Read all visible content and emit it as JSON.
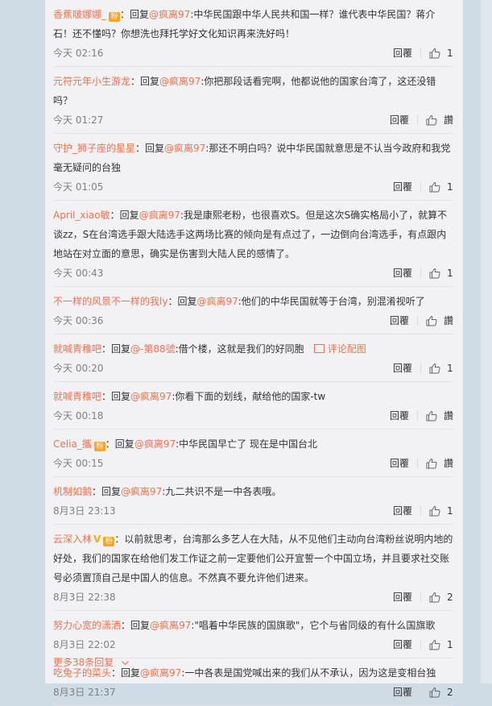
{
  "comments": [
    {
      "user": "香蕉啵娜娜_",
      "badge": "fans",
      "reply_prefix": "：回复",
      "reply_to": "@疯离97",
      "text": ":中华民国跟中华人民共和国一样？谁代表中华民国？蒋介石！还不懂吗？你想洗也拜托学好文化知识再来洗好吗！",
      "time": "今天 02:16",
      "reply": "回覆",
      "likes": "1"
    },
    {
      "user": "元符元年小生游龙",
      "reply_prefix": "：回复",
      "reply_to": "@疯离97",
      "text": ":你把那段话看完啊，他都说他的国家台湾了，这还没错吗？",
      "time": "今天 01:27",
      "reply": "回覆",
      "likes": "讚"
    },
    {
      "user": "守护_狮子座的星星",
      "reply_prefix": "：回复",
      "reply_to": "@疯离97",
      "text": ":那还不明白吗？说中华民国就意思是不认当今政府和我党  毫无疑问的台独",
      "time": "今天 01:05",
      "reply": "回覆",
      "likes": "1"
    },
    {
      "user": "April_xiao敏",
      "reply_prefix": "：回复",
      "reply_to": "@疯离97",
      "text": ":我是康熙老粉，也很喜欢S。但是这次S确实格局小了，就算不谈zz，S在台湾选手跟大陆选手这两场比赛的倾向是有点过了，一边倒向台湾选手，有点跟内地站在对立面的意思，确实是伤害到大陆人民的感情了。",
      "time": "今天 00:43",
      "reply": "回覆",
      "likes": "1"
    },
    {
      "user": "不一样的风景不一样的我ly",
      "reply_prefix": "：回复",
      "reply_to": "@疯离97",
      "text": ":他们的中华民国就等于台湾，别混淆视听了",
      "time": "今天 00:36",
      "reply": "回覆",
      "likes": "讚"
    },
    {
      "user": "就喊青稚吧",
      "reply_prefix": "：回复",
      "reply_to": "@-第88號",
      "text": ":借个楼，这就是我们的好同胞",
      "image_link": "评论配图",
      "time": "今天 00:20",
      "reply": "回覆",
      "likes": "1"
    },
    {
      "user": "就喊青稚吧",
      "reply_prefix": "：回复",
      "reply_to": "@疯离97",
      "text": ":你看下面的划线，献给他的国家-tw",
      "time": "今天 00:18",
      "reply": "回覆",
      "likes": "讚"
    },
    {
      "user": "Celia_攜",
      "badge": "fans",
      "reply_prefix": "：回复",
      "reply_to": "@疯离97",
      "text": ":中华民国早亡了  现在是中国台北",
      "time": "今天 00:15",
      "reply": "回覆",
      "likes": "讚"
    },
    {
      "user": "机制如鹅",
      "reply_prefix": "：回复",
      "reply_to": "@疯离97",
      "text": ":九二共识不是一中各表哦。",
      "time": "8月3日 23:13",
      "reply": "回覆",
      "likes": "1"
    },
    {
      "user": "云深入林",
      "vip": "V",
      "badge": "fans",
      "reply_prefix": "",
      "reply_to": "",
      "text": "：以前就思考，台湾那么多艺人在大陆，从不见他们主动向台湾粉丝说明内地的好处，我们的国家在给他们发工作证之前一定要他们公开宣誓一个中国立场，并且要求社交账号必须置顶自己是中国人的信息。不然真不要允许他们进来。",
      "time": "8月3日 22:38",
      "reply": "回覆",
      "likes": "2"
    },
    {
      "user": "努力心宽的潇洒",
      "reply_prefix": "：回复",
      "reply_to": "@疯离97",
      "text": ":\"唱着中华民族的国旗歌\"，它个与省同级的有什么国旗歌",
      "time": "8月3日 22:02",
      "reply": "回覆",
      "likes": "1"
    },
    {
      "user": "吃兔子的菜头",
      "reply_prefix": "：回复",
      "reply_to": "@疯离97",
      "text": ":一中各表是国党喊出来的我们从不承认，因为这是变相台独",
      "time": "8月3日 21:37",
      "reply": "回覆",
      "likes": "2"
    }
  ],
  "more": {
    "label": "更多38条回复"
  },
  "icons": {
    "like": "thumbs-up-icon",
    "more": "chevron-down-icon",
    "image": "image-icon",
    "badge": "fans-badge-icon"
  },
  "colors": {
    "accent": "#eb7350",
    "background": "#f2f2f5",
    "page": "#cfdbe5"
  }
}
